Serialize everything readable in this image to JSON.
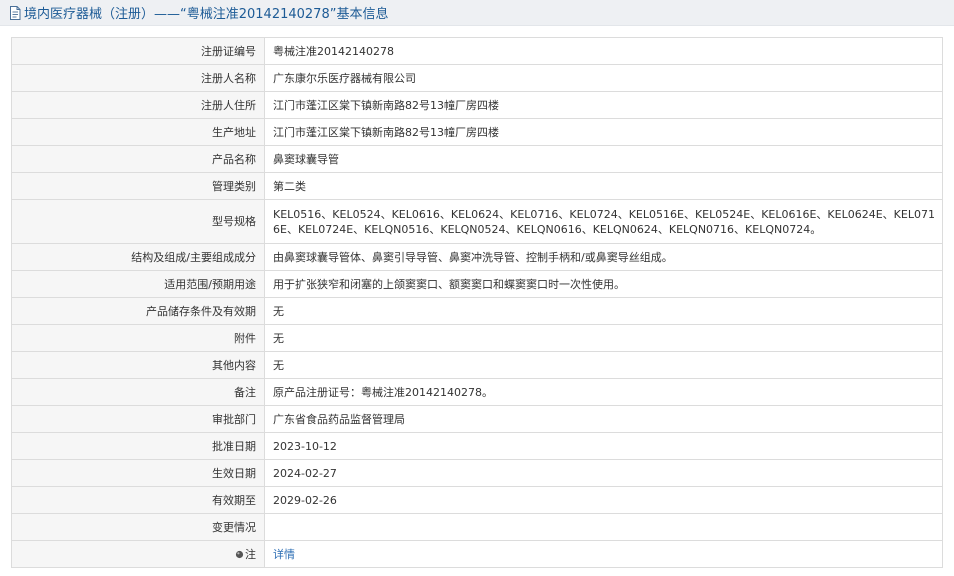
{
  "header": {
    "title": "境内医疗器械（注册）——“粤械注准20142140278”基本信息",
    "icon": "document-icon"
  },
  "rows": [
    {
      "key": "reg-number",
      "label": "注册证编号",
      "value": "粤械注准20142140278"
    },
    {
      "key": "registrant-name",
      "label": "注册人名称",
      "value": "广东康尔乐医疗器械有限公司"
    },
    {
      "key": "registrant-address",
      "label": "注册人住所",
      "value": "江门市蓬江区棠下镇新南路82号13幢厂房四楼"
    },
    {
      "key": "production-address",
      "label": "生产地址",
      "value": "江门市蓬江区棠下镇新南路82号13幢厂房四楼"
    },
    {
      "key": "product-name",
      "label": "产品名称",
      "value": "鼻窦球囊导管"
    },
    {
      "key": "management-class",
      "label": "管理类别",
      "value": "第二类"
    },
    {
      "key": "model-spec",
      "label": "型号规格",
      "value": "KEL0516、KEL0524、KEL0616、KEL0624、KEL0716、KEL0724、KEL0516E、KEL0524E、KEL0616E、KEL0624E、KEL0716E、KEL0724E、KELQN0516、KELQN0524、KELQN0616、KELQN0624、KELQN0716、KELQN0724。"
    },
    {
      "key": "structure",
      "label": "结构及组成/主要组成成分",
      "value": "由鼻窦球囊导管体、鼻窦引导导管、鼻窦冲洗导管、控制手柄和/或鼻窦导丝组成。"
    },
    {
      "key": "intended-use",
      "label": "适用范围/预期用途",
      "value": "用于扩张狭窄和闭塞的上颌窦窦口、额窦窦口和蝶窦窦口时一次性使用。"
    },
    {
      "key": "storage",
      "label": "产品储存条件及有效期",
      "value": "无"
    },
    {
      "key": "attachment",
      "label": "附件",
      "value": "无"
    },
    {
      "key": "other",
      "label": "其他内容",
      "value": "无"
    },
    {
      "key": "remarks",
      "label": "备注",
      "value": "原产品注册证号：粤械注准20142140278。"
    },
    {
      "key": "approval-dept",
      "label": "审批部门",
      "value": "广东省食品药品监督管理局"
    },
    {
      "key": "approval-date",
      "label": "批准日期",
      "value": "2023-10-12"
    },
    {
      "key": "effective-date",
      "label": "生效日期",
      "value": "2024-02-27"
    },
    {
      "key": "expiry-date",
      "label": "有效期至",
      "value": "2029-02-26"
    },
    {
      "key": "changes",
      "label": "变更情况",
      "value": ""
    }
  ],
  "note_row": {
    "label": "注",
    "icon": "bullet-dot-icon",
    "link_text": "详情"
  },
  "colors": {
    "title_bar_bg": "#eef0f3",
    "title_text": "#1d5b96",
    "label_bg": "#f6f6f6",
    "border": "#dcdcdc",
    "link": "#2a6cb3"
  }
}
